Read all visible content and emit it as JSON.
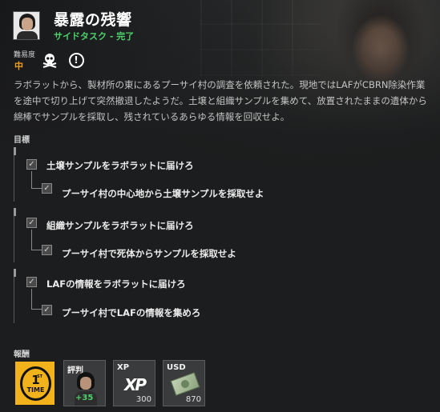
{
  "mission": {
    "title": "暴露の残響",
    "subtitle": "サイドタスク - 完了",
    "difficulty_label": "難易度",
    "difficulty_value": "中",
    "description": "ラボラットから、製材所の東にあるプーサイ村の調査を依頼された。現地ではLAFがCBRN除染作業を途中で切り上げて突然撤退したようだ。土壌と組織サンプルを集めて、放置されたままの遺体から綿棒でサンプルを採取し、残されているあらゆる情報を回収せよ。",
    "icons": [
      "skull-icon",
      "alert-icon"
    ]
  },
  "objectives": {
    "label": "目標",
    "groups": [
      {
        "main": "土壌サンプルをラボラットに届けろ",
        "sub": "プーサイ村の中心地から土壌サンプルを採取せよ",
        "main_checked": true,
        "sub_checked": true
      },
      {
        "main": "組織サンプルをラボラットに届けろ",
        "sub": "プーサイ村で死体からサンプルを採取せよ",
        "main_checked": true,
        "sub_checked": true
      },
      {
        "main": "LAFの情報をラボラットに届けろ",
        "sub": "プーサイ村でLAFの情報を集めろ",
        "main_checked": true,
        "sub_checked": true
      }
    ]
  },
  "rewards": {
    "label": "報酬",
    "first_time": {
      "big": "1",
      "st": "ST",
      "small": "TIME"
    },
    "reputation": {
      "label": "評判",
      "value": "+35"
    },
    "xp": {
      "label": "XP",
      "logo": "XP",
      "value": "300"
    },
    "usd": {
      "label": "USD",
      "value": "870"
    }
  },
  "colors": {
    "accent_green": "#4cd36a",
    "difficulty_orange": "#f0a020",
    "first_time_yellow": "#f2b21c"
  }
}
